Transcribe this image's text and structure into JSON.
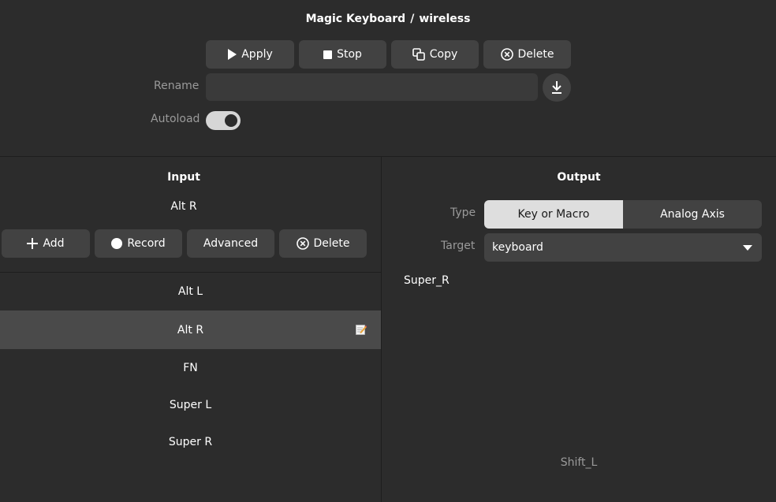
{
  "header": {
    "device": "Magic Keyboard",
    "separator": "/",
    "preset": "wireless"
  },
  "toolbar": {
    "apply": "Apply",
    "stop": "Stop",
    "copy": "Copy",
    "delete": "Delete"
  },
  "rename": {
    "label": "Rename",
    "value": "",
    "placeholder": ""
  },
  "autoload": {
    "label": "Autoload",
    "enabled": true
  },
  "input": {
    "title": "Input",
    "current": "Alt R",
    "buttons": {
      "add": "Add",
      "record": "Record",
      "advanced": "Advanced",
      "delete": "Delete"
    },
    "items": [
      {
        "label": "Alt L"
      },
      {
        "label": "Alt R",
        "selected": true
      },
      {
        "label": "FN"
      },
      {
        "label": "Super L"
      },
      {
        "label": "Super R"
      }
    ]
  },
  "output": {
    "title": "Output",
    "type_label": "Type",
    "type_options": [
      "Key or Macro",
      "Analog Axis"
    ],
    "type_selected": "Key or Macro",
    "target_label": "Target",
    "target_value": "keyboard",
    "editor_text": "Super_R",
    "suggestion": "Shift_L"
  },
  "colors": {
    "background": "#2c2c2c",
    "button": "#424242",
    "selected_row": "#4a4a4a",
    "active_segment": "#dedede"
  }
}
